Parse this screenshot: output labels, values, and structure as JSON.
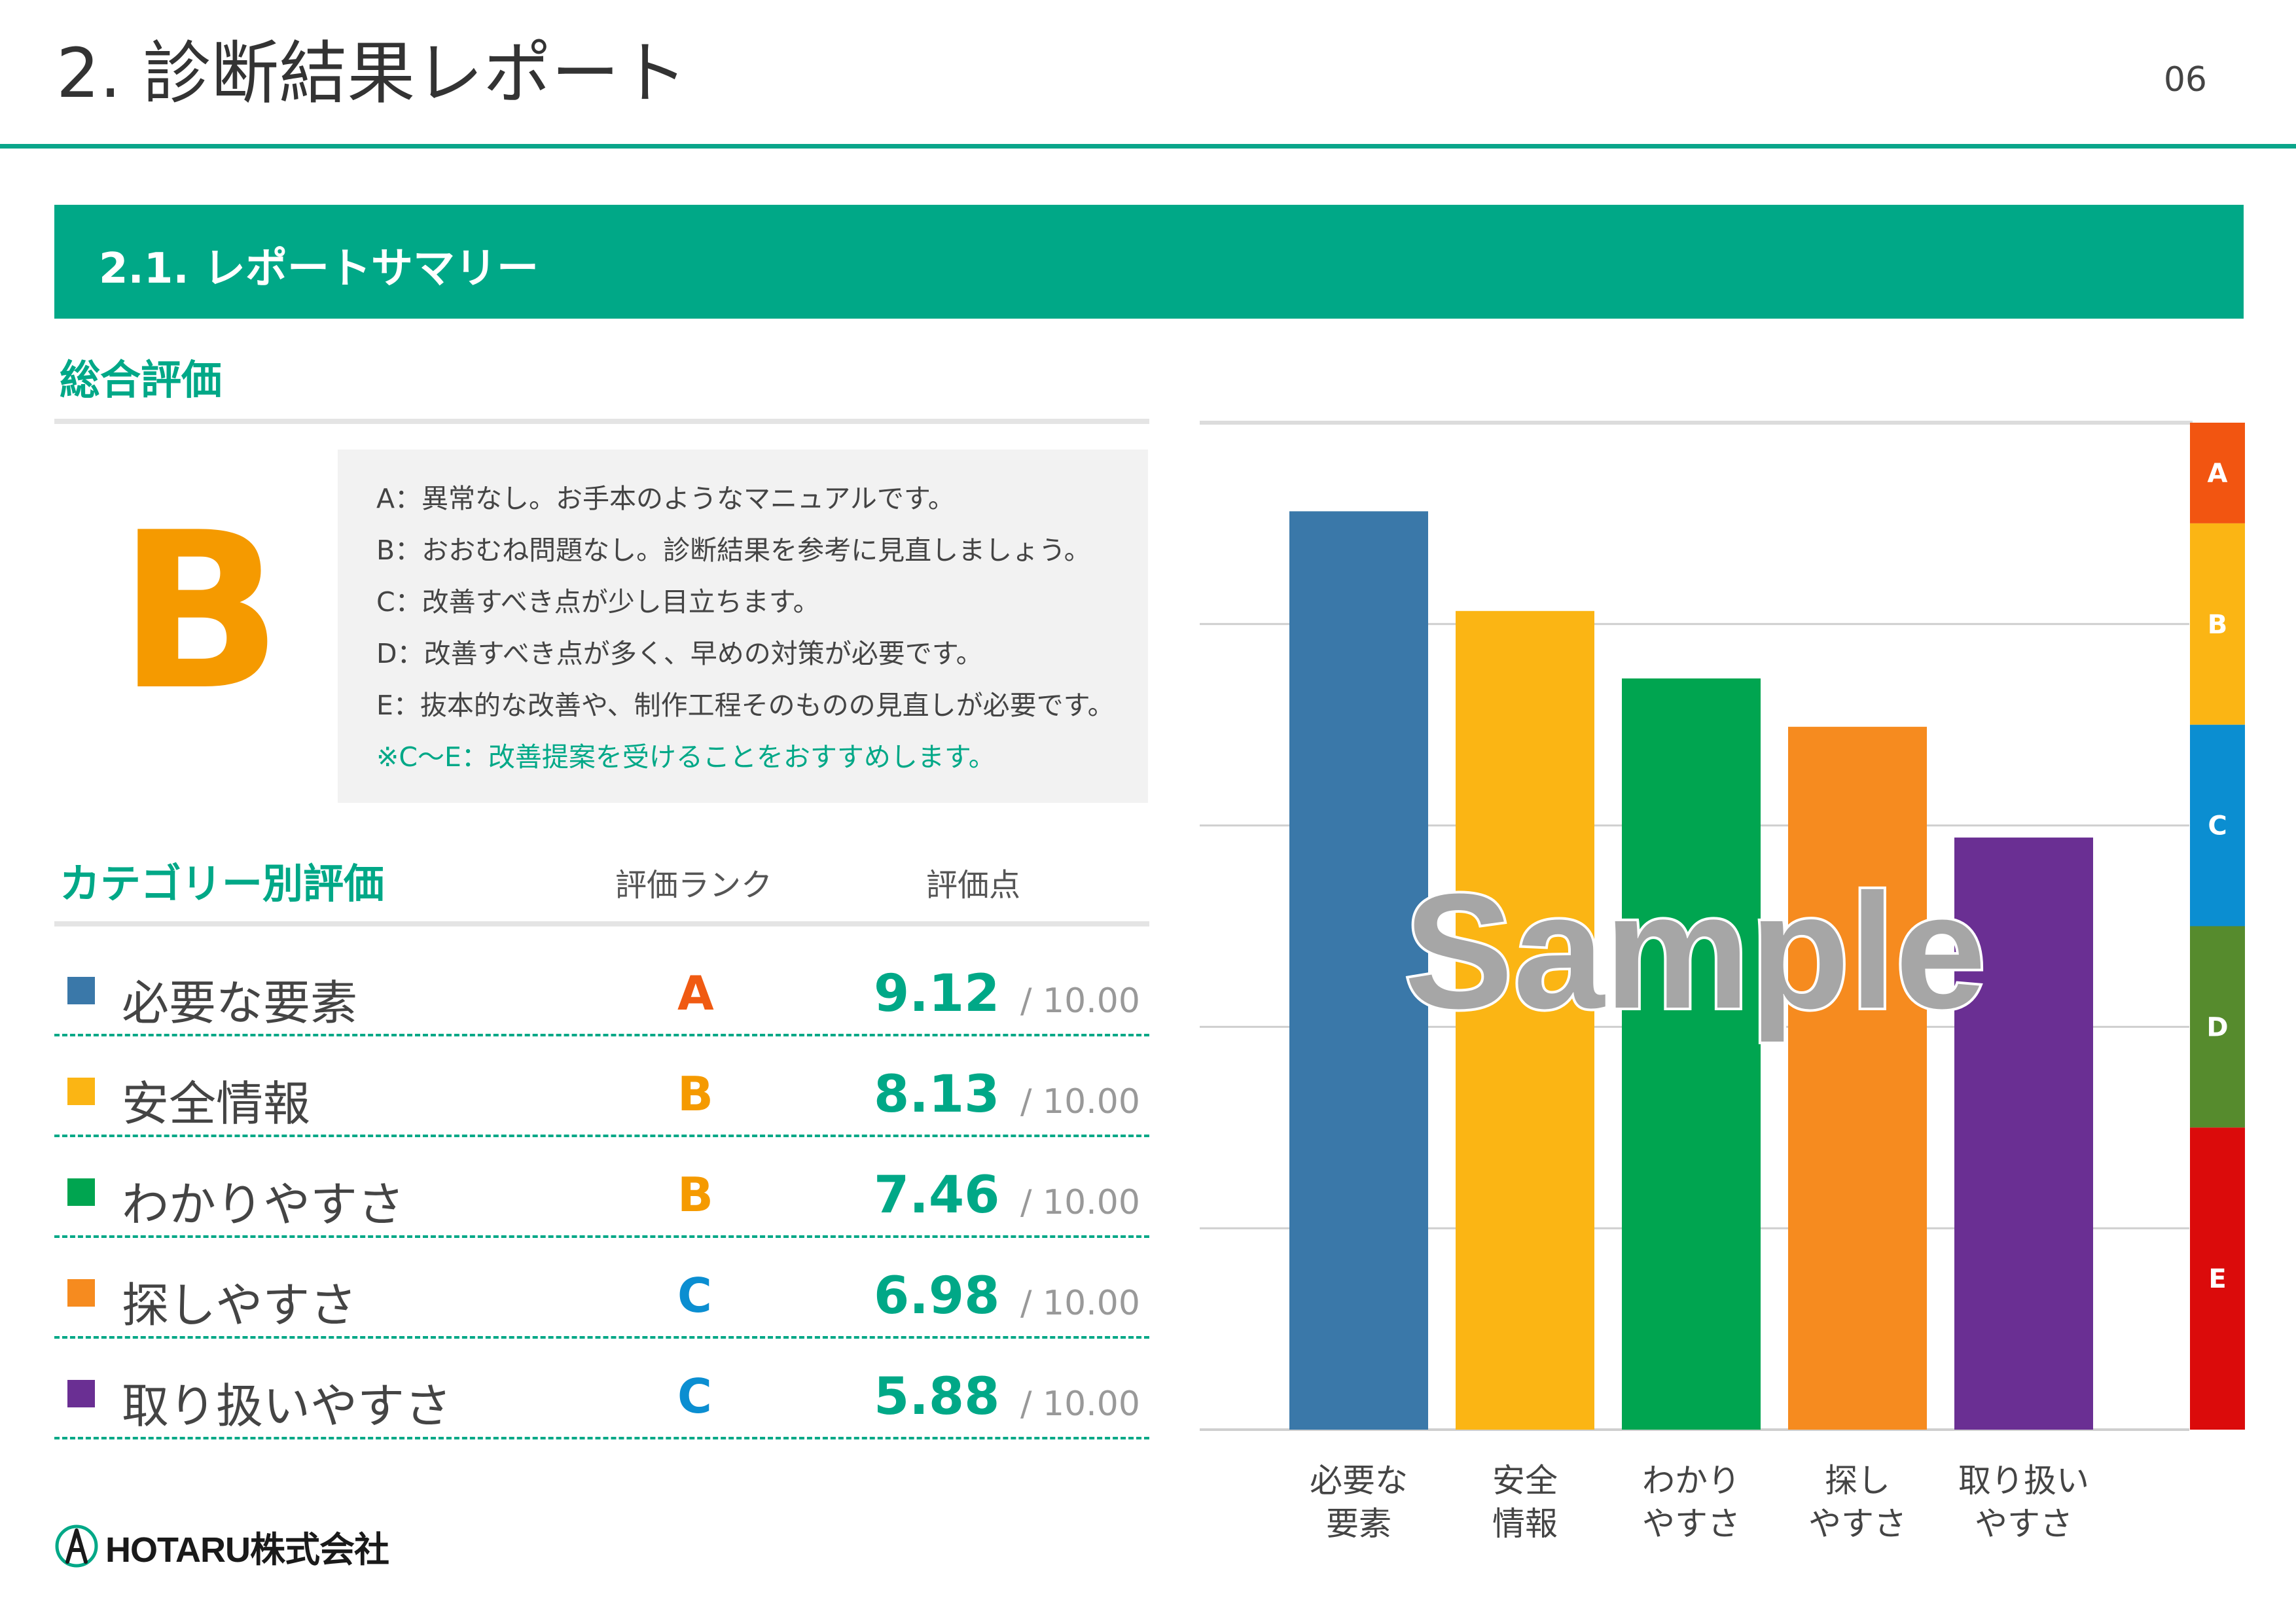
{
  "header": {
    "title": "2. 診断結果レポート",
    "page_number": "06"
  },
  "section": {
    "title": "2.1. レポートサマリー"
  },
  "overall": {
    "heading": "総合評価",
    "grade": "B",
    "grade_color": "#f59a00",
    "legend": [
      "A：異常なし。お手本のようなマニュアルです。",
      "B：おおむね問題なし。診断結果を参考に見直しましょう。",
      "C：改善すべき点が少し目立ちます。",
      "D：改善すべき点が多く、早めの対策が必要です。",
      "E：抜本的な改善や、制作工程そのものの見直しが必要です。"
    ],
    "legend_note": "※C〜E：改善提案を受けることをおすすめします。"
  },
  "category_table": {
    "heading": "カテゴリー別評価",
    "col_rank": "評価ランク",
    "col_score": "評価点",
    "rows": [
      {
        "label": "必要な要素",
        "rank": "A",
        "score": "9.12",
        "max": "/ 10.00",
        "color": "#3a78a9",
        "rank_color": "#f05a12"
      },
      {
        "label": "安全情報",
        "rank": "B",
        "score": "8.13",
        "max": "/ 10.00",
        "color": "#fbb514",
        "rank_color": "#f59a00"
      },
      {
        "label": "わかりやすさ",
        "rank": "B",
        "score": "7.46",
        "max": "/ 10.00",
        "color": "#00a550",
        "rank_color": "#f59a00"
      },
      {
        "label": "探しやすさ",
        "rank": "C",
        "score": "6.98",
        "max": "/ 10.00",
        "color": "#f68b1f",
        "rank_color": "#0b8ed1"
      },
      {
        "label": "取り扱いやすさ",
        "rank": "C",
        "score": "5.88",
        "max": "/ 10.00",
        "color": "#6a2f93",
        "rank_color": "#0b8ed1"
      }
    ]
  },
  "chart_data": {
    "type": "bar",
    "categories": [
      "必要な\n要素",
      "安全\n情報",
      "わかり\nやすさ",
      "探し\nやすさ",
      "取り扱い\nやすさ"
    ],
    "values": [
      9.12,
      8.13,
      7.46,
      6.98,
      5.88
    ],
    "colors": [
      "#3a78a9",
      "#fbb514",
      "#00a550",
      "#f68b1f",
      "#6a2f93"
    ],
    "ylim": [
      0,
      10
    ],
    "grid": true,
    "rank_bands": [
      {
        "label": "A",
        "from": 9.0,
        "to": 10.0,
        "color": "#f25511"
      },
      {
        "label": "B",
        "from": 7.0,
        "to": 9.0,
        "color": "#fbb514"
      },
      {
        "label": "C",
        "from": 5.0,
        "to": 7.0,
        "color": "#0b8ed1"
      },
      {
        "label": "D",
        "from": 3.0,
        "to": 5.0,
        "color": "#568b2d"
      },
      {
        "label": "E",
        "from": 0.0,
        "to": 3.0,
        "color": "#db0b0b"
      }
    ],
    "watermark": "Sample"
  },
  "footer": {
    "logo_text": "HOTARU株式会社"
  }
}
